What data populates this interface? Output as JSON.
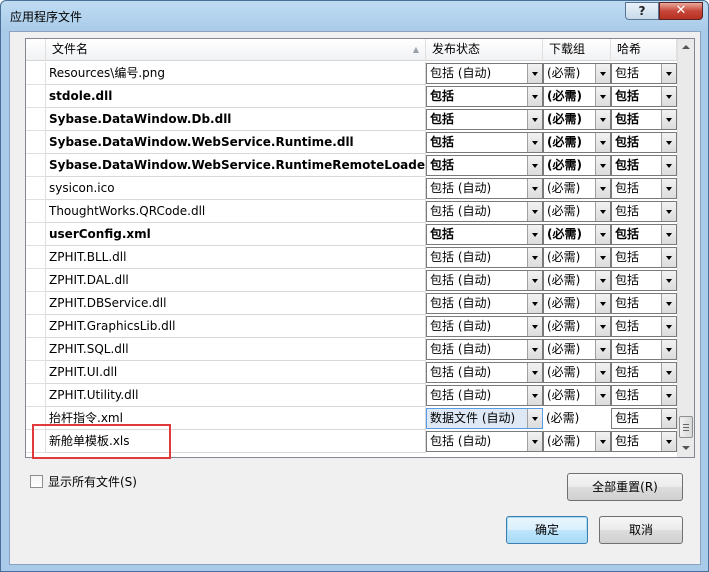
{
  "window": {
    "title": "应用程序文件",
    "help_glyph": "?",
    "close_glyph": "✕"
  },
  "grid": {
    "columns": {
      "name": "文件名",
      "status": "发布状态",
      "download": "下载组",
      "hash": "哈希"
    },
    "rows": [
      {
        "name": "Resources\\编号.png",
        "bold": false,
        "status": "包括 (自动)",
        "download": "(必需)",
        "hash": "包括"
      },
      {
        "name": "stdole.dll",
        "bold": true,
        "status": "包括",
        "download": "(必需)",
        "hash": "包括"
      },
      {
        "name": "Sybase.DataWindow.Db.dll",
        "bold": true,
        "status": "包括",
        "download": "(必需)",
        "hash": "包括"
      },
      {
        "name": "Sybase.DataWindow.WebService.Runtime.dll",
        "bold": true,
        "status": "包括",
        "download": "(必需)",
        "hash": "包括"
      },
      {
        "name": "Sybase.DataWindow.WebService.RuntimeRemoteLoader.dll",
        "bold": true,
        "status": "包括",
        "download": "(必需)",
        "hash": "包括"
      },
      {
        "name": "sysicon.ico",
        "bold": false,
        "status": "包括 (自动)",
        "download": "(必需)",
        "hash": "包括"
      },
      {
        "name": "ThoughtWorks.QRCode.dll",
        "bold": false,
        "status": "包括 (自动)",
        "download": "(必需)",
        "hash": "包括"
      },
      {
        "name": "userConfig.xml",
        "bold": true,
        "status": "包括",
        "download": "(必需)",
        "hash": "包括"
      },
      {
        "name": "ZPHIT.BLL.dll",
        "bold": false,
        "status": "包括 (自动)",
        "download": "(必需)",
        "hash": "包括"
      },
      {
        "name": "ZPHIT.DAL.dll",
        "bold": false,
        "status": "包括 (自动)",
        "download": "(必需)",
        "hash": "包括"
      },
      {
        "name": "ZPHIT.DBService.dll",
        "bold": false,
        "status": "包括 (自动)",
        "download": "(必需)",
        "hash": "包括"
      },
      {
        "name": "ZPHIT.GraphicsLib.dll",
        "bold": false,
        "status": "包括 (自动)",
        "download": "(必需)",
        "hash": "包括"
      },
      {
        "name": "ZPHIT.SQL.dll",
        "bold": false,
        "status": "包括 (自动)",
        "download": "(必需)",
        "hash": "包括"
      },
      {
        "name": "ZPHIT.UI.dll",
        "bold": false,
        "status": "包括 (自动)",
        "download": "(必需)",
        "hash": "包括"
      },
      {
        "name": "ZPHIT.Utility.dll",
        "bold": false,
        "status": "包括 (自动)",
        "download": "(必需)",
        "hash": "包括"
      },
      {
        "name": "抬杆指令.xml",
        "bold": false,
        "status": "数据文件 (自动)",
        "download": "(必需)",
        "hash": "包括",
        "highlight": true
      },
      {
        "name": "新舱单模板.xls",
        "bold": false,
        "status": "包括 (自动)",
        "download": "(必需)",
        "hash": "包括"
      }
    ]
  },
  "show_all_files": {
    "label": "显示所有文件(S)",
    "checked": false
  },
  "buttons": {
    "reset_all": "全部重置(R)",
    "ok": "确定",
    "cancel": "取消"
  },
  "colors": {
    "annotation_box": "#e23a3a",
    "selection_fill": "#dfe9f5"
  }
}
